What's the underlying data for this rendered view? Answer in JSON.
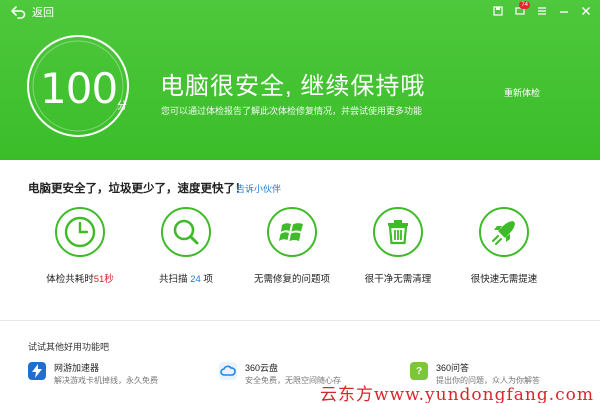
{
  "header": {
    "back_label": "返回",
    "badge": "74",
    "score": "100",
    "score_unit": "分",
    "headline": "电脑很安全, 继续保持哦",
    "subline": "您可以通过体检报告了解此次体检修复情况，并尝试使用更多功能",
    "recheck_label": "重新体检"
  },
  "result": {
    "text": "电脑更安全了，垃圾更少了，速度更快了！",
    "tell_link": "告诉小伙伴"
  },
  "stats": [
    {
      "icon": "clock-icon",
      "prefix": "体检共耗时",
      "value": "51秒",
      "suffix": "",
      "value_color": "#d9262c"
    },
    {
      "icon": "magnifier-icon",
      "prefix": "共扫描",
      "value": " 24 ",
      "suffix": "项",
      "value_color": "#1e7ad9"
    },
    {
      "icon": "windows-icon",
      "prefix": "无需修复的问题项",
      "value": "",
      "suffix": ""
    },
    {
      "icon": "trash-icon",
      "prefix": "很干净无需清理",
      "value": "",
      "suffix": ""
    },
    {
      "icon": "rocket-icon",
      "prefix": "很快速无需提速",
      "value": "",
      "suffix": ""
    }
  ],
  "more": {
    "title": "试试其他好用功能吧",
    "tools": [
      {
        "icon": "lightning-icon",
        "name": "网游加速器",
        "desc": "解决游戏卡机掉线，永久免费"
      },
      {
        "icon": "cloud-icon",
        "name": "360云盘",
        "desc": "安全免费，无限空间随心存"
      },
      {
        "icon": "qa-icon",
        "name": "360问答",
        "desc": "提出你的问题，众人为你解答"
      }
    ]
  },
  "watermark": "云东方www.yundongfang.com",
  "colors": {
    "green": "#3bbd2a",
    "stat_green": "#3fba28",
    "link_blue": "#1e7ad9",
    "red": "#d9262c"
  }
}
